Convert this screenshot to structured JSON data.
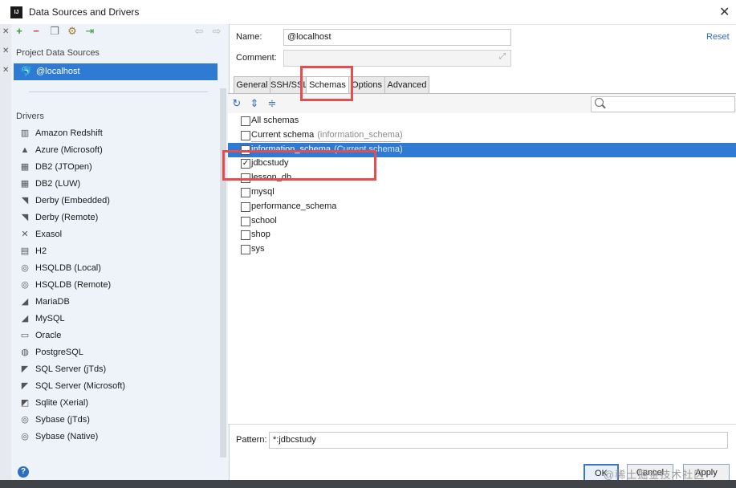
{
  "window": {
    "title": "Data Sources and Drivers",
    "logo": "IJ"
  },
  "left_panel": {
    "toolbar_icons": [
      "add-icon",
      "remove-icon",
      "duplicate-icon",
      "driver-settings-icon",
      "import-icon",
      "back-icon",
      "forward-icon"
    ],
    "project_data_sources_heading": "Project Data Sources",
    "selected_source": "@localhost",
    "drivers_heading": "Drivers",
    "drivers": [
      {
        "label": "Amazon Redshift",
        "icon": "redshift-icon"
      },
      {
        "label": "Azure (Microsoft)",
        "icon": "azure-icon"
      },
      {
        "label": "DB2 (JTOpen)",
        "icon": "db2-icon"
      },
      {
        "label": "DB2 (LUW)",
        "icon": "db2-icon"
      },
      {
        "label": "Derby (Embedded)",
        "icon": "derby-icon"
      },
      {
        "label": "Derby (Remote)",
        "icon": "derby-icon"
      },
      {
        "label": "Exasol",
        "icon": "exasol-icon"
      },
      {
        "label": "H2",
        "icon": "h2-icon"
      },
      {
        "label": "HSQLDB (Local)",
        "icon": "hsqldb-icon"
      },
      {
        "label": "HSQLDB (Remote)",
        "icon": "hsqldb-icon"
      },
      {
        "label": "MariaDB",
        "icon": "mariadb-icon"
      },
      {
        "label": "MySQL",
        "icon": "mysql-icon"
      },
      {
        "label": "Oracle",
        "icon": "oracle-icon"
      },
      {
        "label": "PostgreSQL",
        "icon": "postgresql-icon"
      },
      {
        "label": "SQL Server (jTds)",
        "icon": "sqlserver-icon"
      },
      {
        "label": "SQL Server (Microsoft)",
        "icon": "sqlserver-icon"
      },
      {
        "label": "Sqlite (Xerial)",
        "icon": "sqlite-icon"
      },
      {
        "label": "Sybase (jTds)",
        "icon": "sybase-icon"
      },
      {
        "label": "Sybase (Native)",
        "icon": "sybase-icon"
      }
    ],
    "help_label": "?"
  },
  "form": {
    "name_label": "Name:",
    "name_value": "@localhost",
    "reset_label": "Reset",
    "comment_label": "Comment:",
    "comment_value": ""
  },
  "tabs": [
    "General",
    "SSH/SSL",
    "Schemas",
    "Options",
    "Advanced"
  ],
  "active_tab": "Schemas",
  "schemas": [
    {
      "label": "All schemas",
      "hint": "",
      "checked": false,
      "selected": false
    },
    {
      "label": "Current schema",
      "hint": "(information_schema)",
      "checked": false,
      "selected": false
    },
    {
      "label": "information_schema",
      "hint": "(Current schema)",
      "checked": false,
      "selected": true
    },
    {
      "label": "jdbcstudy",
      "hint": "",
      "checked": true,
      "selected": false
    },
    {
      "label": "lesson_db",
      "hint": "",
      "checked": false,
      "selected": false
    },
    {
      "label": "mysql",
      "hint": "",
      "checked": false,
      "selected": false
    },
    {
      "label": "performance_schema",
      "hint": "",
      "checked": false,
      "selected": false
    },
    {
      "label": "school",
      "hint": "",
      "checked": false,
      "selected": false
    },
    {
      "label": "shop",
      "hint": "",
      "checked": false,
      "selected": false
    },
    {
      "label": "sys",
      "hint": "",
      "checked": false,
      "selected": false
    }
  ],
  "pattern": {
    "label": "Pattern:",
    "value": "*:jdbcstudy"
  },
  "buttons": {
    "ok": "OK",
    "cancel": "Cancel",
    "apply": "Apply"
  },
  "watermark": "@稀土掘金技术社区",
  "colors": {
    "selection": "#2f7bd4",
    "highlight_box": "#e34f4f",
    "link": "#2f6fc0"
  }
}
